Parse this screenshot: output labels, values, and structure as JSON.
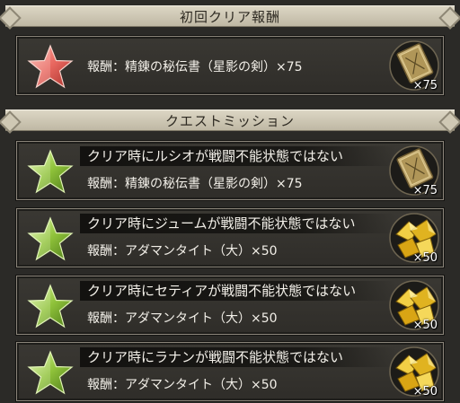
{
  "colors": {
    "first_star": "#e8675f",
    "quest_star": "#8fc23a",
    "header_bg": "#d3ccb8",
    "panel_bg": "#33312d"
  },
  "first_clear": {
    "header": "初回クリア報酬",
    "reward_text": "報酬：精錬の秘伝書（星影の剣）×75",
    "item_icon": "book-icon",
    "item_qty": "×75"
  },
  "quest_mission": {
    "header": "クエストミッション",
    "missions": [
      {
        "condition": "クリア時にルシオが戦闘不能状態ではない",
        "reward_text": "報酬：精錬の秘伝書（星影の剣）×75",
        "item_icon": "book-icon",
        "item_qty": "×75"
      },
      {
        "condition": "クリア時にジュームが戦闘不能状態ではない",
        "reward_text": "報酬：アダマンタイト（大）×50",
        "item_icon": "adamantite-icon",
        "item_qty": "×50"
      },
      {
        "condition": "クリア時にセティアが戦闘不能状態ではない",
        "reward_text": "報酬：アダマンタイト（大）×50",
        "item_icon": "adamantite-icon",
        "item_qty": "×50"
      },
      {
        "condition": "クリア時にラナンが戦闘不能状態ではない",
        "reward_text": "報酬：アダマンタイト（大）×50",
        "item_icon": "adamantite-icon",
        "item_qty": "×50"
      }
    ]
  }
}
